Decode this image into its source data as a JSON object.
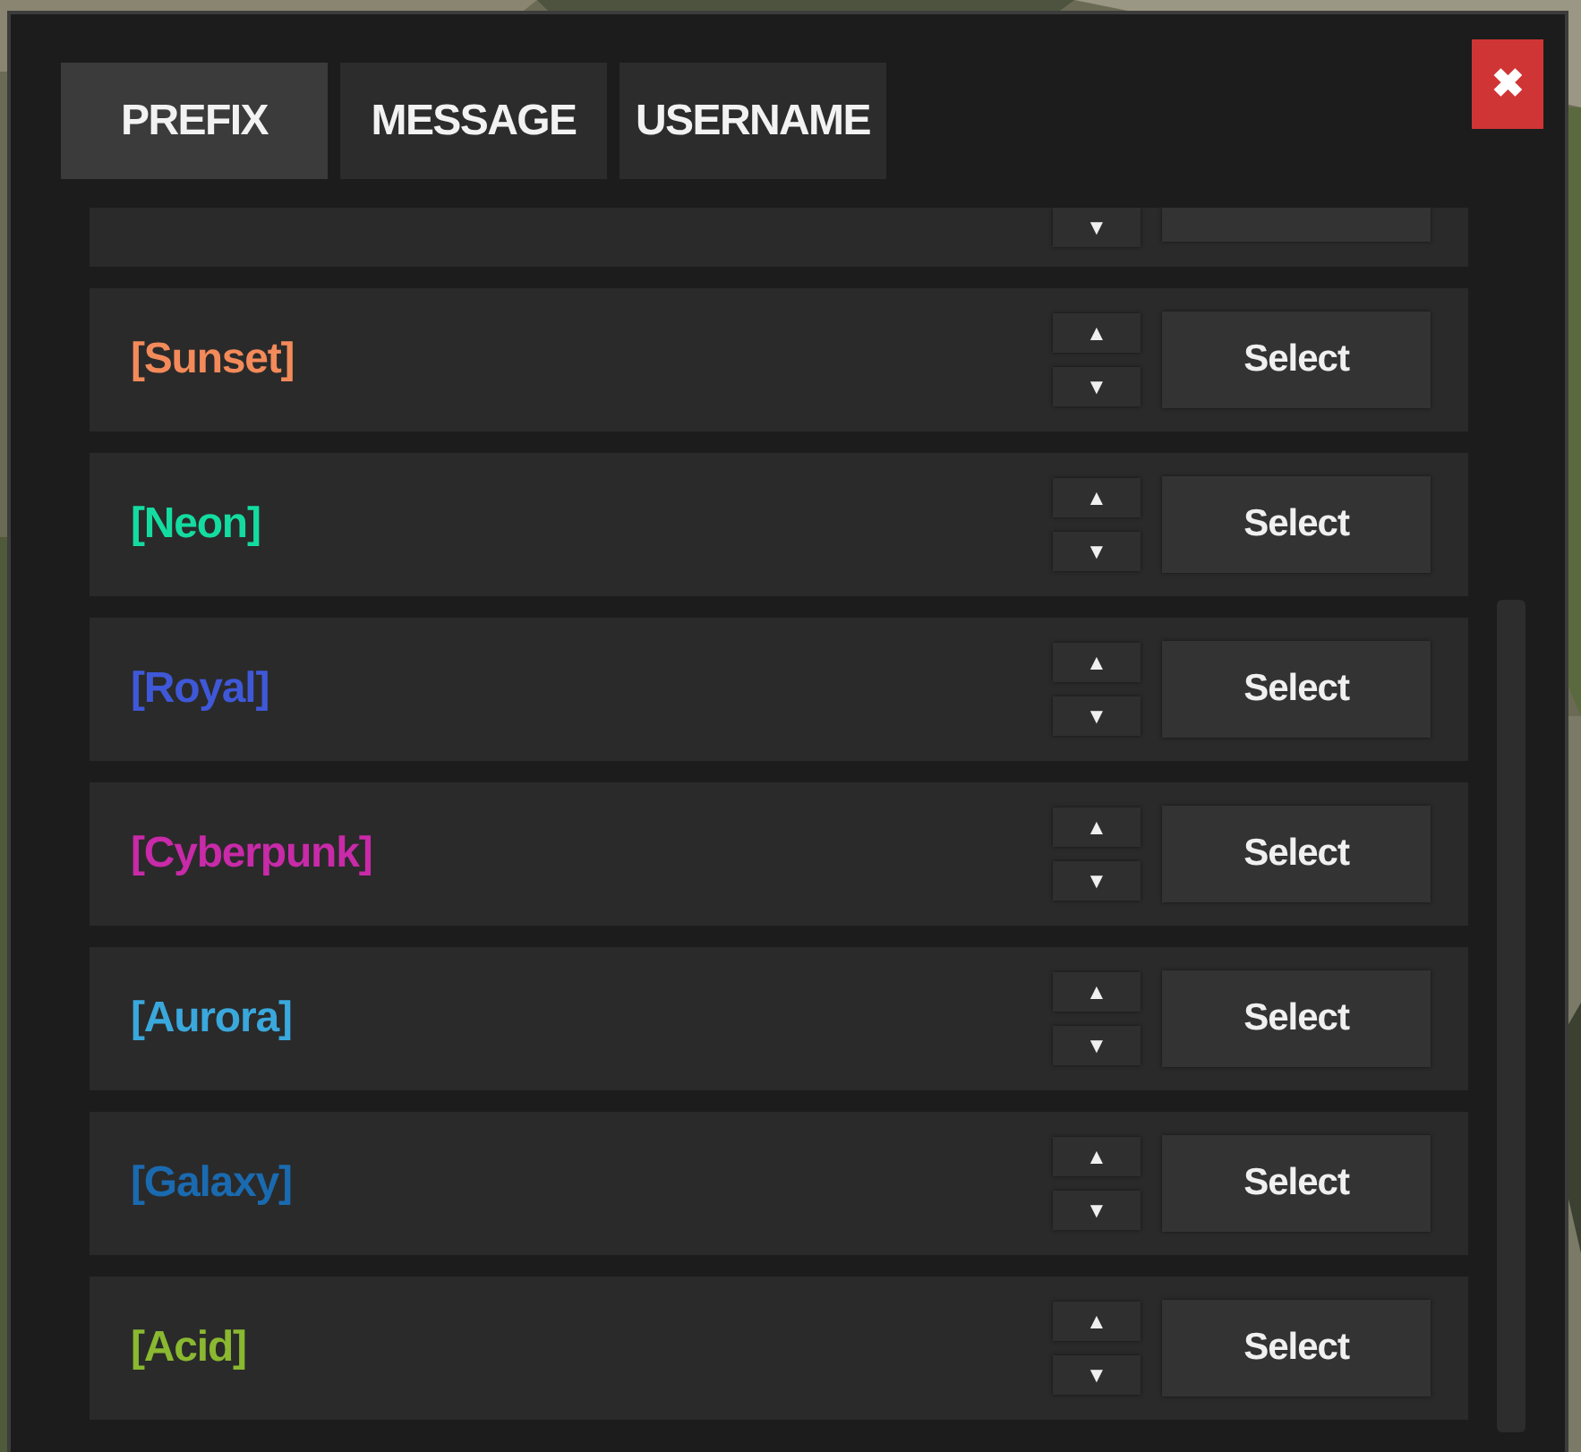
{
  "tabs": [
    {
      "label": "PREFIX",
      "selected": true
    },
    {
      "label": "MESSAGE",
      "selected": false
    },
    {
      "label": "USERNAME",
      "selected": false
    }
  ],
  "close": "✖",
  "partial_row": {
    "down": "▼"
  },
  "rows": [
    {
      "name": "[Sunset]",
      "color": "#f38a5a",
      "up": "▲",
      "down": "▼",
      "button": "Select"
    },
    {
      "name": "[Neon]",
      "color": "#14dca0",
      "up": "▲",
      "down": "▼",
      "button": "Select"
    },
    {
      "name": "[Royal]",
      "color": "#3f58d8",
      "up": "▲",
      "down": "▼",
      "button": "Select"
    },
    {
      "name": "[Cyberpunk]",
      "color": "#c82aa8",
      "up": "▲",
      "down": "▼",
      "button": "Select"
    },
    {
      "name": "[Aurora]",
      "color": "#3aa8dc",
      "up": "▲",
      "down": "▼",
      "button": "Select"
    },
    {
      "name": "[Galaxy]",
      "color": "#1a6ab0",
      "up": "▲",
      "down": "▼",
      "button": "Select"
    },
    {
      "name": "[Acid]",
      "color": "#8ab830",
      "up": "▲",
      "down": "▼",
      "button": "Select"
    }
  ]
}
